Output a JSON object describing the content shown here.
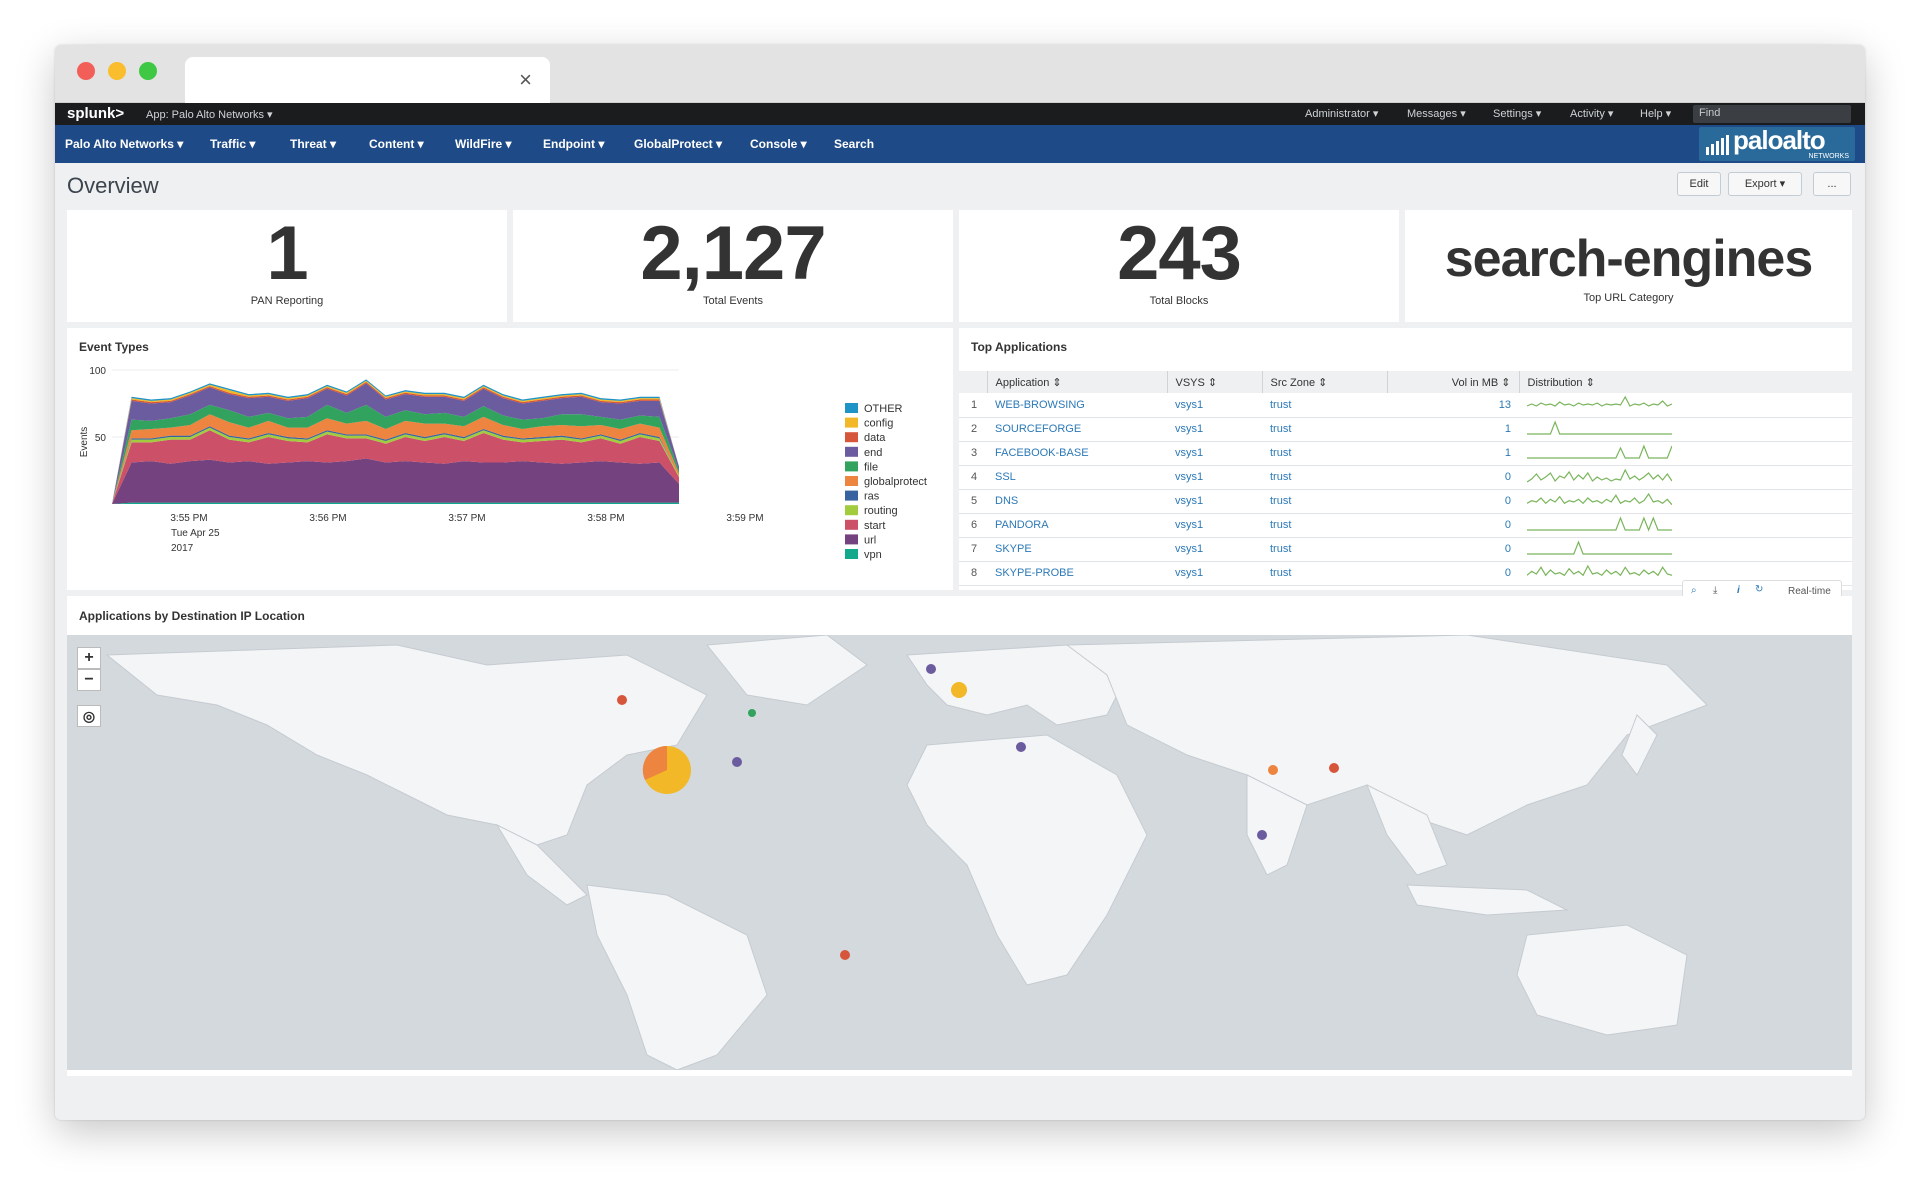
{
  "topbar": {
    "logo": "splunk>",
    "app": "App: Palo Alto Networks ▾",
    "right": [
      "Administrator ▾",
      "Messages ▾",
      "Settings ▾",
      "Activity ▾",
      "Help ▾"
    ],
    "find_placeholder": "Find"
  },
  "nav": {
    "items": [
      "Palo Alto Networks ▾",
      "Traffic ▾",
      "Threat ▾",
      "Content ▾",
      "WildFire ▾",
      "Endpoint ▾",
      "GlobalProtect ▾",
      "Console ▾",
      "Search"
    ],
    "brand": "paloalto",
    "brand_sub": "NETWORKS"
  },
  "page": {
    "title": "Overview",
    "buttons": {
      "edit": "Edit",
      "export": "Export ▾",
      "more": "..."
    }
  },
  "kpis": [
    {
      "value": "1",
      "label": "PAN Reporting"
    },
    {
      "value": "2,127",
      "label": "Total Events"
    },
    {
      "value": "243",
      "label": "Total Blocks"
    },
    {
      "value": "search-engines",
      "label": "Top URL Category"
    }
  ],
  "event_types": {
    "title": "Event Types",
    "chart_data": {
      "type": "area",
      "stacked": true,
      "ylabel": "Events",
      "ytick_labels": [
        "100",
        "50"
      ],
      "x_tick_labels": [
        "3:55 PM",
        "3:56 PM",
        "3:57 PM",
        "3:58 PM",
        "3:59 PM"
      ],
      "x_date_labels": [
        "Tue Apr 25",
        "2017"
      ],
      "legend_placement": "right",
      "series": [
        {
          "name": "OTHER",
          "color": "#1e93c6",
          "values": [
            0,
            1,
            1,
            1,
            1,
            1,
            1,
            1,
            1,
            1,
            1,
            1,
            1,
            1,
            1,
            1,
            1,
            1,
            1,
            1,
            1,
            1,
            1,
            1,
            1,
            1,
            1,
            1,
            1,
            0
          ]
        },
        {
          "name": "config",
          "color": "#f2b827",
          "values": [
            0,
            1,
            1,
            1,
            1,
            1,
            2,
            1,
            1,
            1,
            1,
            1,
            1,
            1,
            1,
            1,
            1,
            1,
            1,
            1,
            1,
            1,
            1,
            1,
            1,
            1,
            1,
            1,
            1,
            0
          ]
        },
        {
          "name": "data",
          "color": "#d6563c",
          "values": [
            0,
            1,
            1,
            1,
            1,
            1,
            1,
            1,
            1,
            1,
            1,
            1,
            1,
            1,
            1,
            1,
            1,
            1,
            1,
            1,
            1,
            1,
            1,
            1,
            1,
            1,
            1,
            1,
            1,
            0
          ]
        },
        {
          "name": "end",
          "color": "#6a5c9e",
          "values": [
            0,
            14,
            13,
            12,
            14,
            13,
            12,
            14,
            12,
            13,
            14,
            12,
            13,
            16,
            13,
            12,
            13,
            12,
            12,
            13,
            13,
            12,
            13,
            12,
            13,
            11,
            12,
            11,
            12,
            3
          ]
        },
        {
          "name": "file",
          "color": "#31a35f",
          "values": [
            0,
            8,
            6,
            7,
            8,
            7,
            9,
            8,
            6,
            7,
            8,
            10,
            8,
            12,
            9,
            8,
            7,
            8,
            7,
            8,
            7,
            7,
            6,
            8,
            9,
            6,
            7,
            6,
            8,
            2
          ]
        },
        {
          "name": "globalprotect",
          "color": "#ed8440",
          "values": [
            0,
            6,
            7,
            6,
            8,
            9,
            10,
            8,
            9,
            7,
            8,
            9,
            8,
            10,
            8,
            9,
            10,
            7,
            8,
            9,
            8,
            7,
            8,
            8,
            9,
            7,
            8,
            7,
            7,
            2
          ]
        },
        {
          "name": "ras",
          "color": "#3863a0",
          "values": [
            0,
            1,
            1,
            1,
            1,
            1,
            1,
            1,
            1,
            1,
            1,
            1,
            1,
            1,
            1,
            1,
            1,
            1,
            1,
            1,
            1,
            1,
            1,
            1,
            1,
            1,
            1,
            1,
            1,
            0
          ]
        },
        {
          "name": "routing",
          "color": "#a2cc3e",
          "values": [
            0,
            2,
            2,
            2,
            2,
            2,
            2,
            2,
            2,
            2,
            2,
            2,
            2,
            2,
            2,
            2,
            2,
            2,
            2,
            2,
            2,
            2,
            2,
            2,
            2,
            2,
            2,
            2,
            2,
            1
          ]
        },
        {
          "name": "start",
          "color": "#cc5068",
          "values": [
            0,
            15,
            14,
            18,
            16,
            22,
            17,
            14,
            20,
            16,
            14,
            21,
            17,
            15,
            14,
            18,
            16,
            20,
            15,
            22,
            17,
            14,
            16,
            18,
            15,
            17,
            14,
            20,
            16,
            5
          ]
        },
        {
          "name": "url",
          "color": "#73427f",
          "values": [
            0,
            30,
            31,
            29,
            31,
            32,
            30,
            31,
            29,
            30,
            31,
            30,
            31,
            33,
            30,
            31,
            30,
            29,
            31,
            30,
            30,
            31,
            30,
            29,
            30,
            31,
            30,
            29,
            30,
            14
          ]
        },
        {
          "name": "vpn",
          "color": "#11a88b",
          "values": [
            0,
            1,
            1,
            1,
            1,
            1,
            1,
            1,
            1,
            1,
            1,
            1,
            1,
            1,
            1,
            1,
            1,
            1,
            1,
            1,
            1,
            1,
            1,
            1,
            1,
            1,
            1,
            1,
            1,
            1
          ]
        }
      ]
    }
  },
  "top_apps": {
    "title": "Top Applications",
    "columns": [
      "Application ⇕",
      "VSYS ⇕",
      "Src Zone ⇕",
      "Vol in MB ⇕",
      "Distribution ⇕"
    ],
    "rows": [
      {
        "n": "1",
        "app": "WEB-BROWSING",
        "vsys": "vsys1",
        "zone": "trust",
        "vol": "13",
        "spark": [
          3,
          5,
          3,
          6,
          4,
          5,
          3,
          7,
          4,
          5,
          3,
          6,
          4,
          5,
          4,
          6,
          3,
          5,
          4,
          5,
          4,
          12,
          3,
          5,
          4,
          6,
          3,
          5,
          4,
          8,
          3,
          5
        ]
      },
      {
        "n": "2",
        "app": "SOURCEFORGE",
        "vsys": "vsys1",
        "zone": "trust",
        "vol": "1",
        "spark": [
          0,
          0,
          0,
          0,
          0,
          0,
          12,
          0,
          0,
          0,
          0,
          0,
          0,
          0,
          0,
          0,
          0,
          0,
          0,
          0,
          0,
          0,
          0,
          0,
          0,
          0,
          0,
          0,
          0,
          0,
          0,
          0
        ]
      },
      {
        "n": "3",
        "app": "FACEBOOK-BASE",
        "vsys": "vsys1",
        "zone": "trust",
        "vol": "1",
        "spark": [
          0,
          0,
          0,
          0,
          0,
          0,
          0,
          0,
          0,
          0,
          0,
          0,
          0,
          0,
          0,
          0,
          0,
          0,
          0,
          0,
          10,
          0,
          0,
          0,
          0,
          12,
          0,
          0,
          0,
          0,
          0,
          12
        ]
      },
      {
        "n": "4",
        "app": "SSL",
        "vsys": "vsys1",
        "zone": "trust",
        "vol": "0",
        "spark": [
          0,
          3,
          8,
          2,
          5,
          9,
          1,
          6,
          4,
          10,
          2,
          7,
          3,
          9,
          1,
          5,
          2,
          4,
          1,
          3,
          2,
          12,
          3,
          6,
          2,
          5,
          9,
          3,
          7,
          2,
          8,
          1
        ]
      },
      {
        "n": "5",
        "app": "DNS",
        "vsys": "vsys1",
        "zone": "trust",
        "vol": "0",
        "spark": [
          2,
          4,
          3,
          6,
          2,
          5,
          3,
          7,
          2,
          4,
          3,
          5,
          2,
          6,
          3,
          4,
          2,
          5,
          3,
          8,
          2,
          4,
          3,
          6,
          2,
          4,
          9,
          3,
          4,
          2,
          5,
          1
        ]
      },
      {
        "n": "6",
        "app": "PANDORA",
        "vsys": "vsys1",
        "zone": "trust",
        "vol": "0",
        "spark": [
          0,
          0,
          0,
          0,
          0,
          0,
          0,
          0,
          0,
          0,
          0,
          0,
          0,
          0,
          0,
          0,
          0,
          0,
          0,
          0,
          12,
          0,
          0,
          0,
          0,
          12,
          0,
          12,
          0,
          0,
          0,
          0
        ]
      },
      {
        "n": "7",
        "app": "SKYPE",
        "vsys": "vsys1",
        "zone": "trust",
        "vol": "0",
        "spark": [
          0,
          0,
          0,
          0,
          0,
          0,
          0,
          0,
          0,
          0,
          0,
          10,
          0,
          0,
          0,
          0,
          0,
          0,
          0,
          0,
          0,
          0,
          0,
          0,
          0,
          0,
          0,
          0,
          0,
          0,
          0,
          0
        ]
      },
      {
        "n": "8",
        "app": "SKYPE-PROBE",
        "vsys": "vsys1",
        "zone": "trust",
        "vol": "0",
        "spark": [
          2,
          5,
          3,
          8,
          2,
          6,
          3,
          4,
          2,
          7,
          3,
          5,
          2,
          9,
          3,
          4,
          2,
          6,
          3,
          5,
          2,
          8,
          3,
          4,
          2,
          6,
          3,
          5,
          2,
          8,
          3,
          2
        ]
      }
    ],
    "realtime_label": "Real-time"
  },
  "map": {
    "title": "Applications by Destination IP Location",
    "zoom_in": "+",
    "zoom_out": "−"
  }
}
